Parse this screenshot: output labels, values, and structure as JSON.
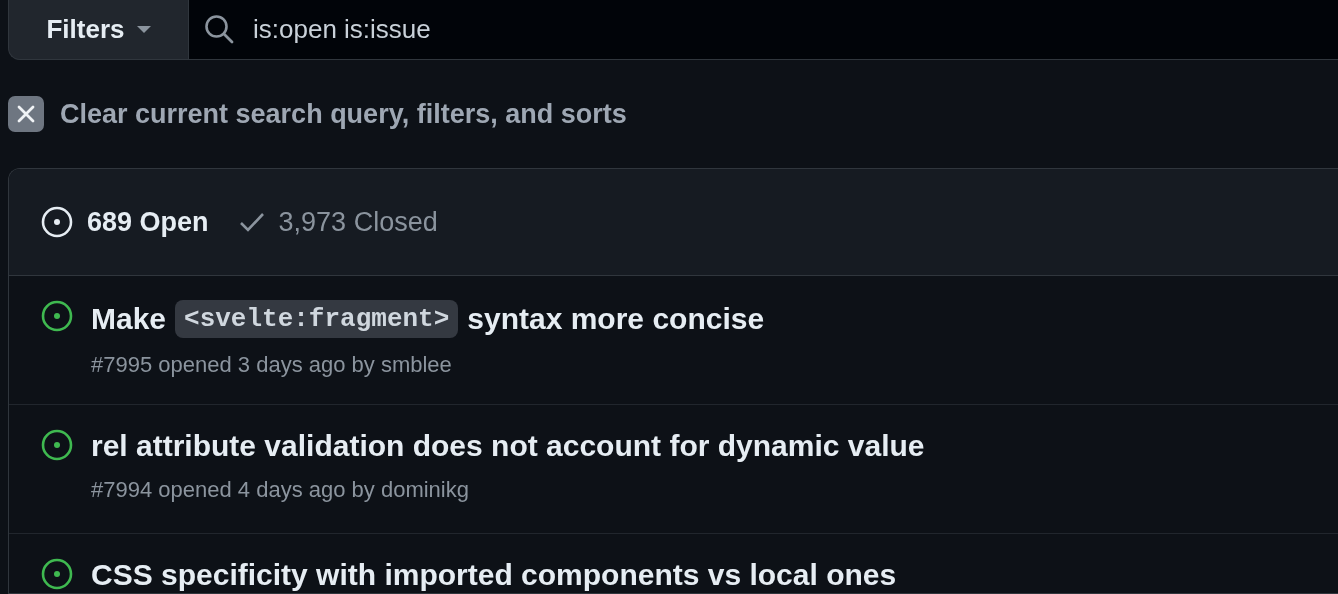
{
  "filters_button": {
    "label": "Filters"
  },
  "search": {
    "value": "is:open is:issue"
  },
  "clear_filters": {
    "label": "Clear current search query, filters, and sorts"
  },
  "state_tabs": [
    {
      "kind": "open",
      "label": "689 Open",
      "selected": true
    },
    {
      "kind": "closed",
      "label": "3,973 Closed",
      "selected": false
    }
  ],
  "issues": [
    {
      "title": [
        {
          "kind": "text",
          "text": "Make"
        },
        {
          "kind": "code",
          "text": "<svelte:fragment>"
        },
        {
          "kind": "text",
          "text": "syntax more concise"
        }
      ],
      "meta": "#7995 opened 3 days ago by smblee"
    },
    {
      "title": [
        {
          "kind": "text",
          "text": "rel attribute validation does not account for dynamic value"
        }
      ],
      "meta": "#7994 opened 4 days ago by dominikg"
    },
    {
      "title": [
        {
          "kind": "text",
          "text": "CSS specificity with imported components vs local ones"
        }
      ]
    }
  ]
}
